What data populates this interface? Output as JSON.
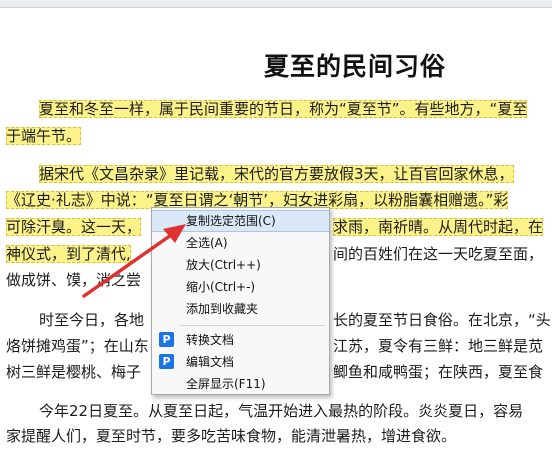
{
  "doc": {
    "title": "夏至的民间习俗",
    "lines": [
      "夏至和冬至一样，属于民间重要的节日，称为“夏至节”。有些地方，“夏至",
      "于端午节。",
      "据宋代《文昌杂录》里记载，宋代的官方要放假3天，让百官回家休息，",
      "《辽史·礼志》中说：“夏至日谓之‘朝节’，妇女进彩扇，以粉脂囊相赠遗。”彩",
      "可除汗臭。这一天，",
      "求雨，南祈晴。从周代时起，在",
      "神仪式，到了清代,",
      "间的百姓们在这一天吃夏至面，",
      "做成饼、馍，消之尝",
      "时至今日，各地",
      "长的夏至节日食俗。在北京，“头",
      "烙饼摊鸡蛋”；在山东",
      "江苏，夏令有三鲜：地三鲜是苋",
      "树三鲜是樱桃、梅子",
      "鲫鱼和咸鸭蛋；在陕西，夏至食",
      "今年22日夏至。从夏至日起，气温开始进入最热的阶段。炎炎夏日，容易",
      "家提醒人们，夏至时节，要多吃苦味食物，能清泄暑热，增进食欲。"
    ]
  },
  "menu": {
    "items": [
      {
        "label": "复制选定范围(C)",
        "icon": ""
      },
      {
        "label": "全选(A)",
        "icon": ""
      },
      {
        "label": "放大(Ctrl++)",
        "icon": ""
      },
      {
        "label": "缩小(Ctrl+-)",
        "icon": ""
      },
      {
        "label": "添加到收藏夹",
        "icon": ""
      },
      {
        "label": "转换文档",
        "icon": "p-app-icon"
      },
      {
        "label": "编辑文档",
        "icon": "p-app-icon"
      },
      {
        "label": "全屏显示(F11)",
        "icon": ""
      }
    ],
    "icon_glyph": "P"
  },
  "colors": {
    "highlight": "#fbf28a",
    "menu_active": "#dbe8f7",
    "arrow": "#e03131",
    "app_icon": "#1a73e8"
  }
}
